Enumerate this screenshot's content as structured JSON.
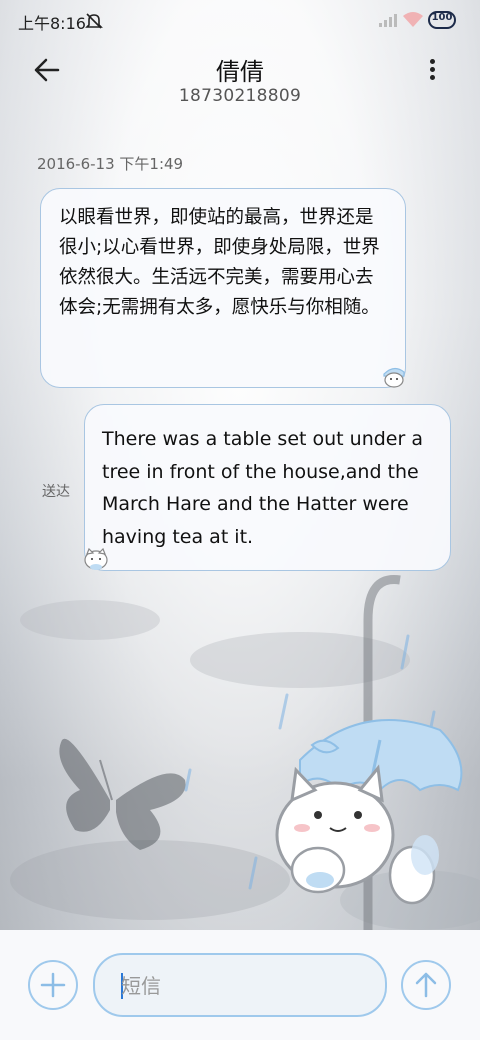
{
  "status_bar": {
    "time": "上午8:16",
    "battery": "100",
    "icons": [
      "mute-icon",
      "signal-icon",
      "wifi-icon",
      "battery-icon"
    ]
  },
  "header": {
    "back_icon": "arrow-left-icon",
    "contact_name": "倩倩",
    "phone_number": "18730218809",
    "more_icon": "more-vert-icon"
  },
  "conversation": {
    "timestamp": "2016-6-13 下午1:49",
    "messages": [
      {
        "direction": "incoming",
        "text": "以眼看世界，即使站的最高，世界还是很小;以心看世界，即使身处局限，世界依然很大。生活远不完美，需要用心去体会;无需拥有太多，愿快乐与你相随。"
      },
      {
        "direction": "outgoing",
        "text": "There was a table set out under a tree in front of the house,and the March Hare and the Hatter were having tea at it.",
        "status": "送达"
      }
    ]
  },
  "composer": {
    "add_icon": "plus-icon",
    "placeholder": "短信",
    "value": "",
    "send_icon": "arrow-up-icon"
  },
  "colors": {
    "accent": "#9fc9ec",
    "bubble_border": "#a9c6e2",
    "bubble_bg": "#f8fafd",
    "caret": "#2a78d6"
  }
}
